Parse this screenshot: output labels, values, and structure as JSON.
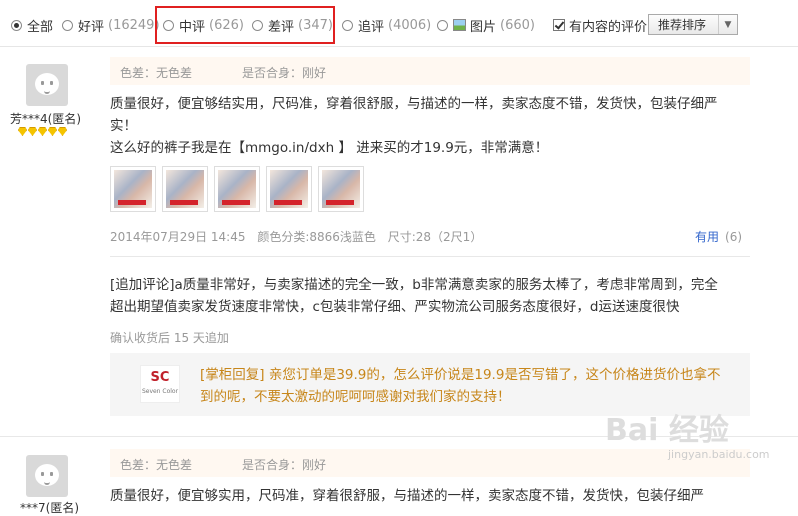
{
  "filters": {
    "all": {
      "label": "全部",
      "count": ""
    },
    "good": {
      "label": "好评",
      "count": "(16249)"
    },
    "medium": {
      "label": "中评",
      "count": "(626)"
    },
    "bad": {
      "label": "差评",
      "count": "(347)"
    },
    "followup": {
      "label": "追评",
      "count": "(4006)"
    },
    "picture": {
      "label": "图片",
      "count": "(660)"
    },
    "with_content": {
      "label": "有内容的评价",
      "checked": true
    },
    "sort": {
      "selected": "推荐排序"
    }
  },
  "reviews": [
    {
      "user": "芳***4(匿名)",
      "meta": {
        "color_diff": "色差：无色差",
        "fit": "是否合身：刚好"
      },
      "text_line1": "质量很好，便宜够结实用，尺码准，穿着很舒服，与描述的一样，卖家态度不错，发货快，包装仔细严",
      "text_line2": "实！",
      "text_line3": "这么好的裤子我是在【mmgo.in/dxh 】 进来买的才19.9元，非常满意！",
      "thumbnail_count": 5,
      "date": "2014年07月29日 14:45",
      "color_class": "颜色分类:8866浅蓝色",
      "size": "尺寸:28（2尺1）",
      "useful_label": "有用",
      "useful_count": "(6)",
      "followup_line1": "[追加评论]a质量非常好，与卖家描述的完全一致，b非常满意卖家的服务太棒了，考虑非常周到，完全",
      "followup_line2": "超出期望值卖家发货速度非常快，c包装非常仔细、严实物流公司服务态度很好，d运送速度很快",
      "followup_note": "确认收货后 15 天追加",
      "reply_logo_text": "SC",
      "reply_logo_sub": "Seven Color",
      "reply_line1": "[掌柜回复] 亲您订单是39.9的，怎么评价说是19.9是否写错了，这个价格进货价也拿不",
      "reply_line2": "到的呢，不要太激动的呢呵呵感谢对我们家的支持！"
    },
    {
      "user": "***7(匿名)",
      "meta": {
        "color_diff": "色差：无色差",
        "fit": "是否合身：刚好"
      },
      "text_line1": "质量很好，便宜够实用，尺码准，穿着很舒服，与描述的一样，卖家态度不错，发货快，包装仔细严"
    }
  ],
  "watermark": {
    "text": "Bai 经验",
    "url": "jingyan.baidu.com"
  }
}
